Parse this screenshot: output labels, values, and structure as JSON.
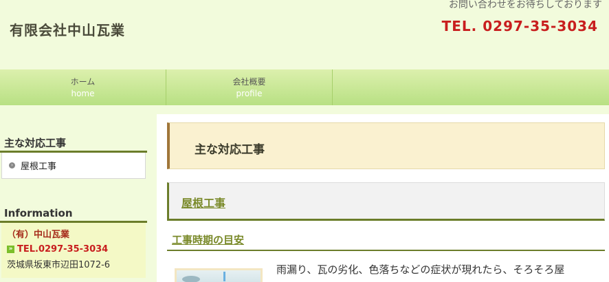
{
  "header": {
    "site_title": "有限会社中山瓦業",
    "contact_note": "お問い合わせをお待ちしております",
    "tel": "TEL. 0297-35-3034"
  },
  "nav": {
    "items": [
      {
        "label": "ホーム",
        "sub": "home"
      },
      {
        "label": "会社概要",
        "sub": "profile"
      }
    ]
  },
  "sidebar": {
    "works_heading": "主な対応工事",
    "works_items": [
      {
        "label": "屋根工事"
      }
    ],
    "info_heading": "Information",
    "info_name": "（有）中山瓦業",
    "info_tel": "TEL.0297-35-3034",
    "info_address": "茨城県坂東市辺田1072-6"
  },
  "main": {
    "page_title": "主な対応工事",
    "sub_title": "屋根工事",
    "section_heading": "工事時期の目安",
    "body_text": "雨漏り、瓦の劣化、色落ちなどの症状が現れたら、そろそろ屋"
  },
  "colors": {
    "accent_olive": "#6b7d2a",
    "tel_red": "#c81e1e",
    "nav_green": "#b8e083",
    "background": "#f2fbdc"
  }
}
